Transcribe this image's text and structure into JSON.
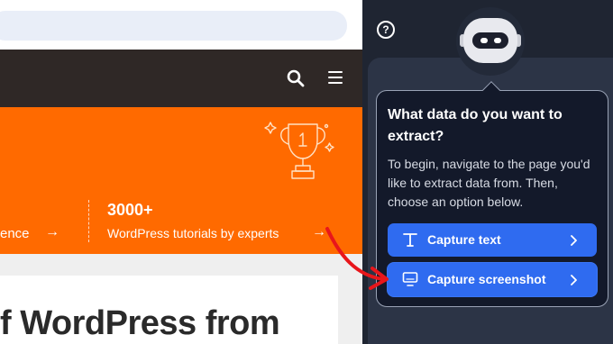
{
  "website": {
    "headline": "f WordPress from",
    "stats": [
      {
        "number": "",
        "label": "ence"
      },
      {
        "number": "3000+",
        "label": "WordPress tutorials by experts"
      }
    ]
  },
  "extension": {
    "help_glyph": "?",
    "prompt_title": "What data do you want to extract?",
    "prompt_body": "To begin, navigate to the page you'd like to extract data from. Then, choose an option below.",
    "buttons": [
      {
        "label": "Capture text",
        "icon": "text-format-icon"
      },
      {
        "label": "Capture screenshot",
        "icon": "monitor-icon"
      }
    ]
  },
  "colors": {
    "hero_orange": "#ff6a00",
    "site_header": "#2f2826",
    "panel_dark": "#1f2532",
    "card_bg": "#13192a",
    "button_blue": "#2f6bf0",
    "annotation_red": "#e8161b"
  }
}
